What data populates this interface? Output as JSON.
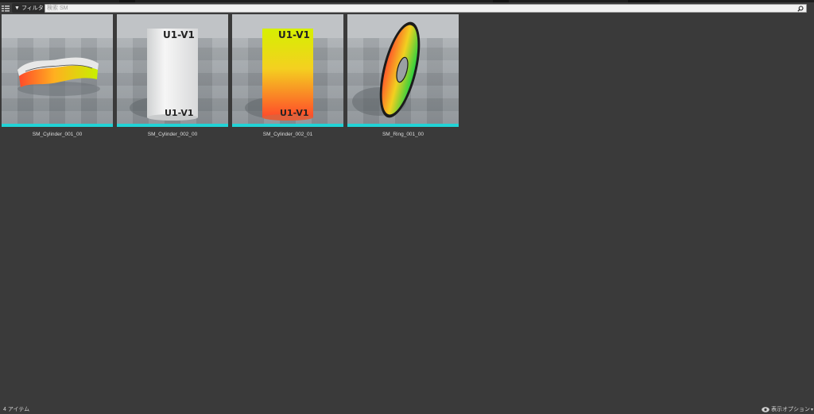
{
  "toolbar": {
    "filter_label": "フィルタ",
    "filter_icon": "funnel-icon",
    "sources_icon": "sources-toggle-icon"
  },
  "search": {
    "placeholder": "検索 SM",
    "value": ""
  },
  "assets": [
    {
      "name": "SM_Cylinder_001_00",
      "preview": "wavy-ring"
    },
    {
      "name": "SM_Cylinder_002_00",
      "preview": "white-cylinder"
    },
    {
      "name": "SM_Cylinder_002_01",
      "preview": "gradient-cylinder"
    },
    {
      "name": "SM_Ring_001_00",
      "preview": "ring"
    }
  ],
  "thumb_text": "U1-V1",
  "status": {
    "item_count": "4 アイテム",
    "view_options_label": "表示オプション"
  },
  "colors": {
    "background": "#3a3a3a",
    "asset_type_bar": "#22d3d6",
    "search_field": "#f1f1f1"
  }
}
